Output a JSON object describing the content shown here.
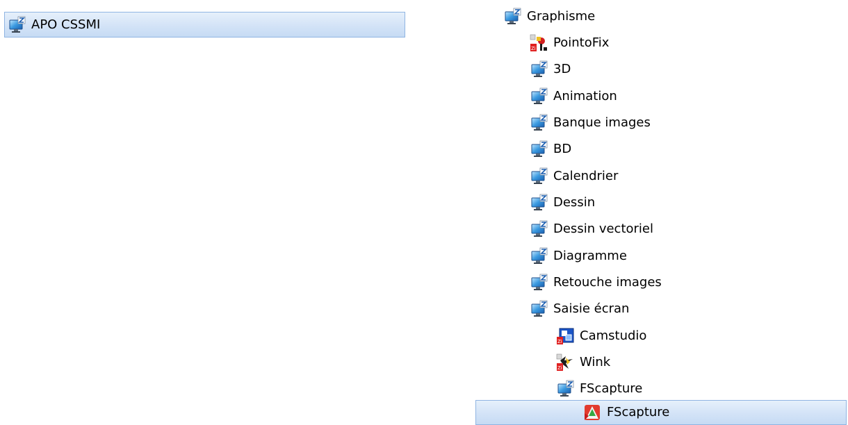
{
  "left_tree": {
    "root": {
      "label": "APO CSSMI",
      "icon": "folder-monitor-icon"
    }
  },
  "right_tree": {
    "items": [
      {
        "label": "Graphisme",
        "icon": "folder-monitor-icon"
      },
      {
        "label": "PointoFix",
        "icon": "pointofix-app-icon"
      },
      {
        "label": "3D",
        "icon": "folder-monitor-icon"
      },
      {
        "label": "Animation",
        "icon": "folder-monitor-icon"
      },
      {
        "label": "Banque images",
        "icon": "folder-monitor-icon"
      },
      {
        "label": "BD",
        "icon": "folder-monitor-icon"
      },
      {
        "label": "Calendrier",
        "icon": "folder-monitor-icon"
      },
      {
        "label": "Dessin",
        "icon": "folder-monitor-icon"
      },
      {
        "label": "Dessin vectoriel",
        "icon": "folder-monitor-icon"
      },
      {
        "label": "Diagramme",
        "icon": "folder-monitor-icon"
      },
      {
        "label": "Retouche images",
        "icon": "folder-monitor-icon"
      },
      {
        "label": "Saisie écran",
        "icon": "folder-monitor-icon"
      },
      {
        "label": "Camstudio",
        "icon": "camstudio-app-icon"
      },
      {
        "label": "Wink",
        "icon": "wink-app-icon"
      },
      {
        "label": "FScapture",
        "icon": "folder-monitor-icon"
      },
      {
        "label": "FScapture",
        "icon": "fscapture-app-icon"
      }
    ]
  },
  "colors": {
    "selection_fill": "#d3e3f7",
    "selection_border": "#8fb4e2",
    "monitor_blue": "#3a8fd6"
  }
}
